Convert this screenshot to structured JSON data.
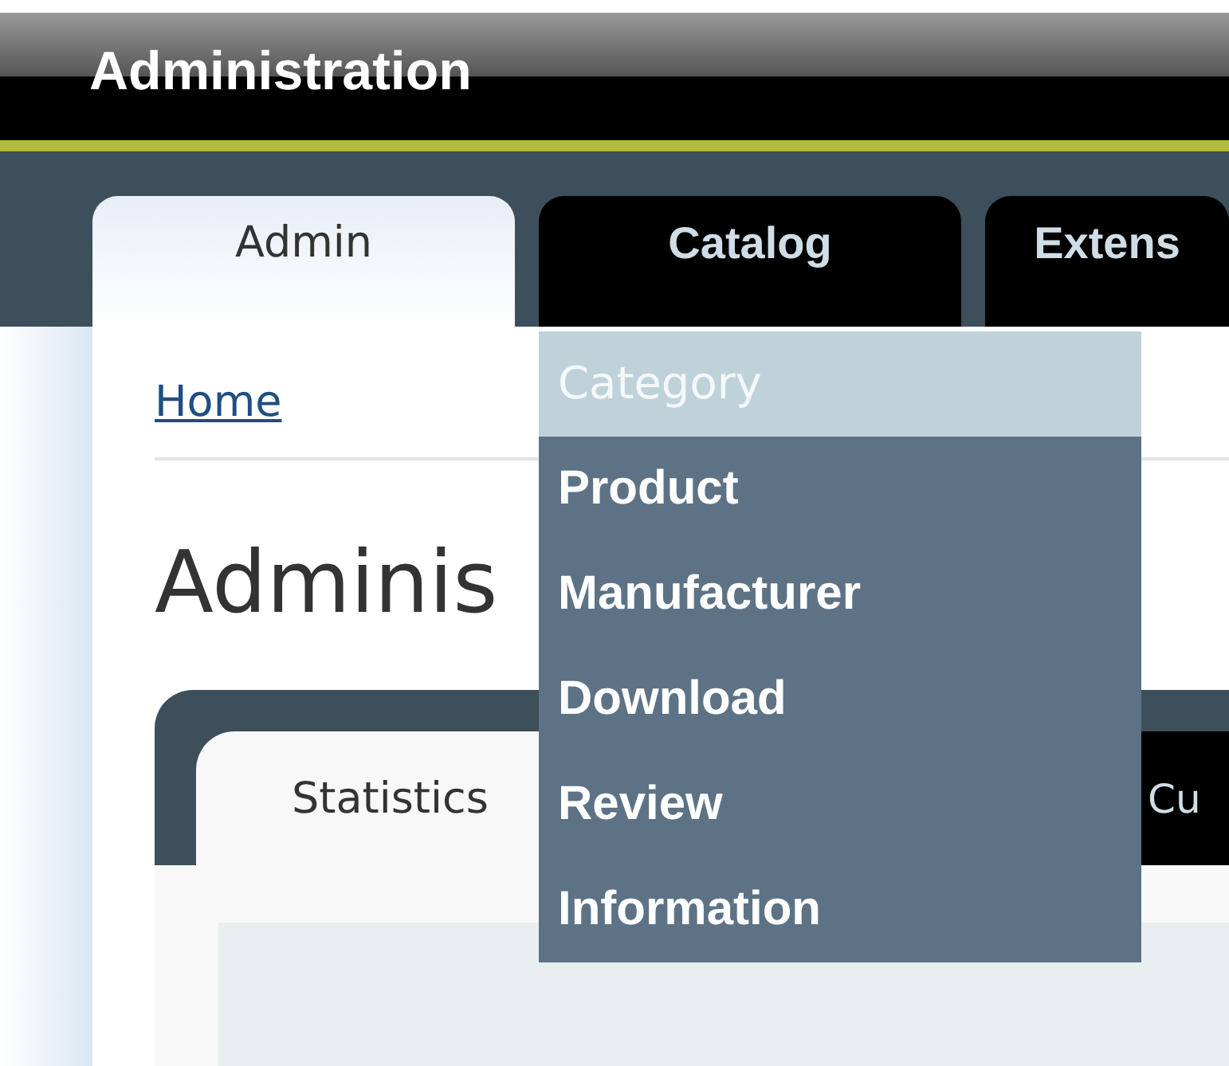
{
  "header": {
    "title": "Administration"
  },
  "tabs": [
    {
      "label": "Admin",
      "selected": true
    },
    {
      "label": "Catalog",
      "selected": false
    },
    {
      "label": "Extens",
      "selected": false
    }
  ],
  "dropdown": {
    "items": [
      {
        "label": "Category",
        "selected": true
      },
      {
        "label": "Product",
        "selected": false
      },
      {
        "label": "Manufacturer",
        "selected": false
      },
      {
        "label": "Download",
        "selected": false
      },
      {
        "label": "Review",
        "selected": false
      },
      {
        "label": "Information",
        "selected": false
      }
    ]
  },
  "breadcrumb": [
    "Home"
  ],
  "heading": "Adminis",
  "panel_tabs": [
    {
      "label": "Statistics",
      "selected": true
    },
    {
      "label": "Cu",
      "selected": false
    }
  ]
}
